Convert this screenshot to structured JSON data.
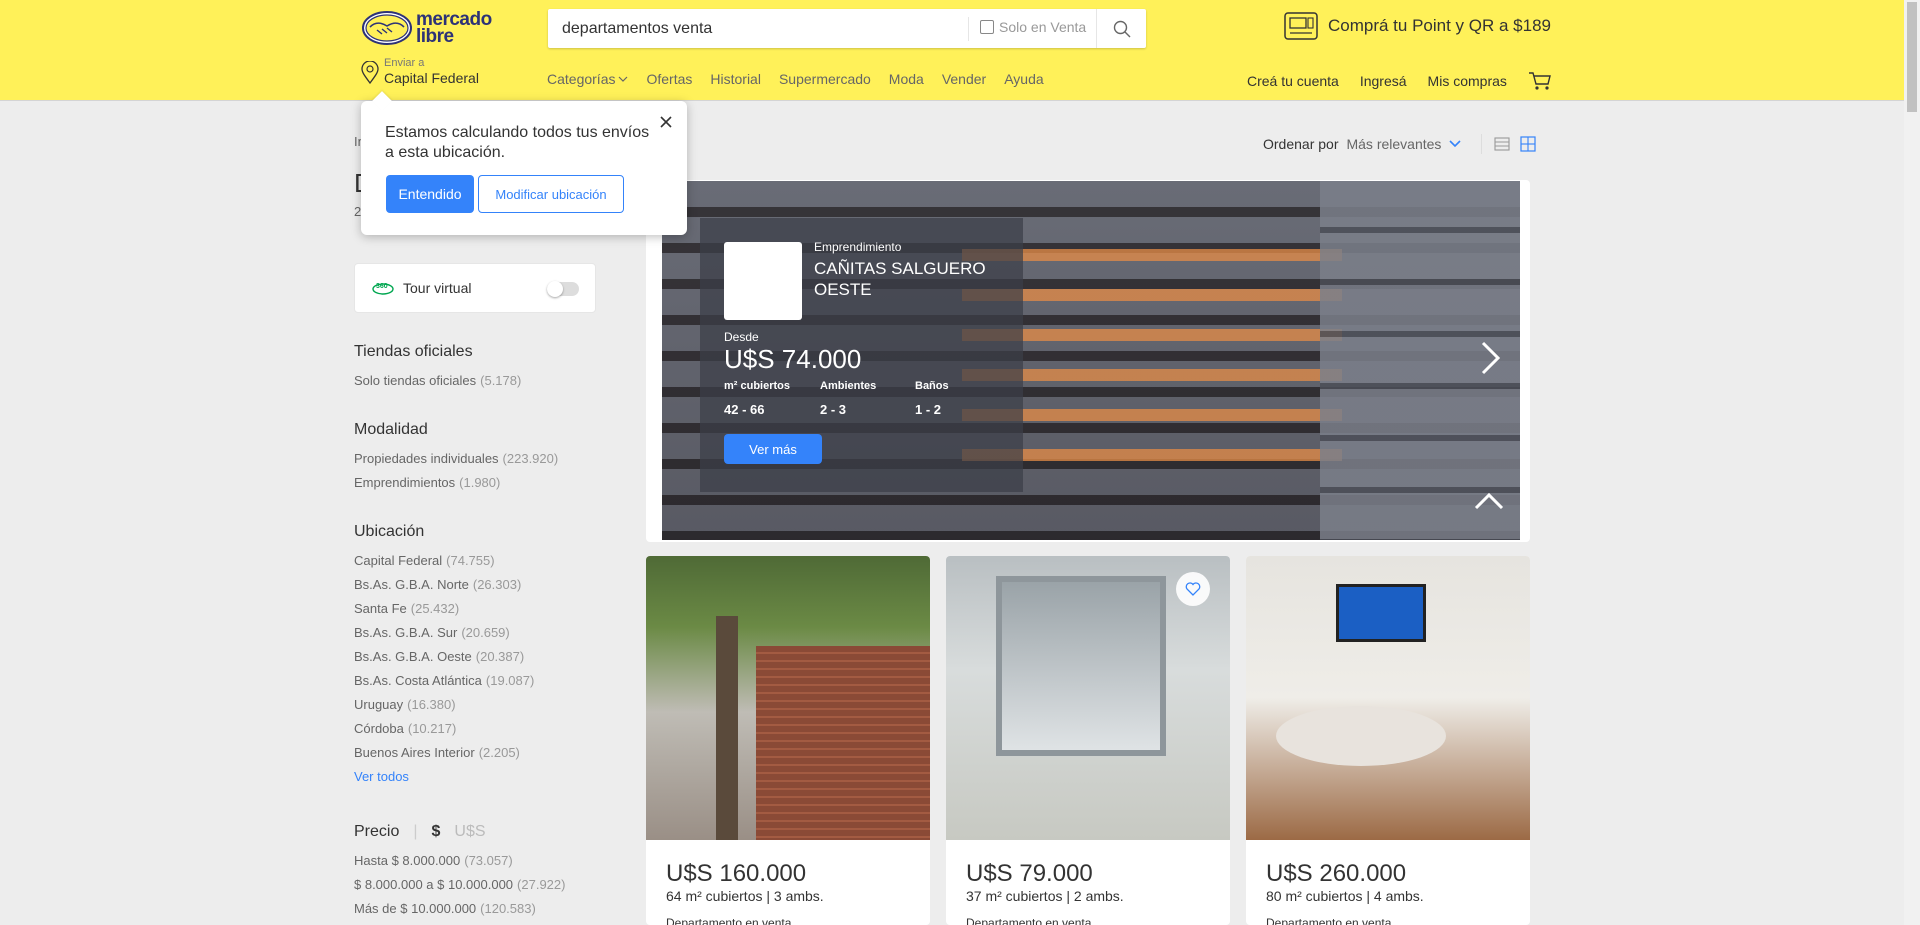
{
  "header": {
    "logo_text_line1": "mercado",
    "logo_text_line2": "libre",
    "search_value": "departamentos venta",
    "solo_en_venta_label": "Solo en Venta",
    "promo_text": "Comprá tu Point y QR a $189",
    "location_small": "Enviar a",
    "location_big": "Capital Federal",
    "nav": [
      "Categorías",
      "Ofertas",
      "Historial",
      "Supermercado",
      "Moda",
      "Vender",
      "Ayuda"
    ],
    "user_nav": [
      "Creá tu cuenta",
      "Ingresá",
      "Mis compras"
    ]
  },
  "popup": {
    "message": "Estamos calculando todos tus envíos a esta ubicación.",
    "primary_button": "Entendido",
    "secondary_button": "Modificar ubicación"
  },
  "peek": {
    "breadcrumb": "In",
    "title": "D",
    "count": "2"
  },
  "sidebar": {
    "tour_label": "Tour virtual",
    "tiendas": {
      "title": "Tiendas oficiales",
      "items": [
        {
          "label": "Solo tiendas oficiales",
          "count": "(5.178)"
        }
      ]
    },
    "modalidad": {
      "title": "Modalidad",
      "items": [
        {
          "label": "Propiedades individuales",
          "count": "(223.920)"
        },
        {
          "label": "Emprendimientos",
          "count": "(1.980)"
        }
      ]
    },
    "ubicacion": {
      "title": "Ubicación",
      "items": [
        {
          "label": "Capital Federal",
          "count": "(74.755)"
        },
        {
          "label": "Bs.As. G.B.A. Norte",
          "count": "(26.303)"
        },
        {
          "label": "Santa Fe",
          "count": "(25.432)"
        },
        {
          "label": "Bs.As. G.B.A. Sur",
          "count": "(20.659)"
        },
        {
          "label": "Bs.As. G.B.A. Oeste",
          "count": "(20.387)"
        },
        {
          "label": "Bs.As. Costa Atlántica",
          "count": "(19.087)"
        },
        {
          "label": "Uruguay",
          "count": "(16.380)"
        },
        {
          "label": "Córdoba",
          "count": "(10.217)"
        },
        {
          "label": "Buenos Aires Interior",
          "count": "(2.205)"
        }
      ],
      "ver_todos": "Ver todos"
    },
    "precio": {
      "title": "Precio",
      "sep": "|",
      "currency_a": "$",
      "currency_b": "U$S",
      "items": [
        {
          "label": "Hasta $ 8.000.000",
          "count": "(73.057)"
        },
        {
          "label": "$ 8.000.000 a $ 10.000.000",
          "count": "(27.922)"
        },
        {
          "label": "Más de $ 10.000.000",
          "count": "(120.583)"
        }
      ]
    }
  },
  "sort": {
    "label": "Ordenar por",
    "value": "Más relevantes"
  },
  "banner": {
    "kind": "Emprendimiento",
    "name": "CAÑITAS SALGUERO OESTE",
    "desde": "Desde",
    "price": "U$S 74.000",
    "attrs": [
      {
        "key": "m² cubiertos",
        "value": "42 - 66"
      },
      {
        "key": "Ambientes",
        "value": "2 - 3"
      },
      {
        "key": "Baños",
        "value": "1 - 2"
      }
    ],
    "cta": "Ver más"
  },
  "cards": [
    {
      "price": "U$S 160.000",
      "attrs": "64 m² cubiertos | 3 ambs.",
      "type": "Departamento en venta"
    },
    {
      "price": "U$S 79.000",
      "attrs": "37 m² cubiertos | 2 ambs.",
      "type": "Departamento en venta"
    },
    {
      "price": "U$S 260.000",
      "attrs": "80 m² cubiertos | 4 ambs.",
      "type": "Departamento en venta"
    }
  ],
  "colors": {
    "header_bg": "#fff159",
    "accent": "#3483fa",
    "page_bg": "#ededed"
  }
}
